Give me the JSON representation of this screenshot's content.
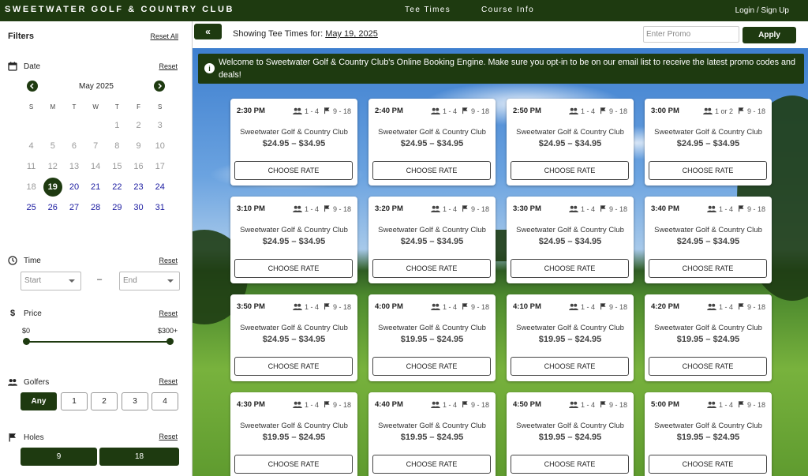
{
  "nav": {
    "brand": "SWEETWATER GOLF & COUNTRY CLUB",
    "links": [
      "Tee Times",
      "Course Info"
    ],
    "login": "Login / Sign Up"
  },
  "filters": {
    "title": "Filters",
    "reset_all": "Reset All",
    "reset": "Reset",
    "date": {
      "label": "Date",
      "month": "May 2025",
      "prev_icon": "chevron-left-icon",
      "next_icon": "chevron-right-icon",
      "weekdays": [
        "S",
        "M",
        "T",
        "W",
        "T",
        "F",
        "S"
      ],
      "days": [
        "",
        "",
        "",
        "",
        "1",
        "2",
        "3",
        "4",
        "5",
        "6",
        "7",
        "8",
        "9",
        "10",
        "11",
        "12",
        "13",
        "14",
        "15",
        "16",
        "17",
        "18",
        "19",
        "20",
        "21",
        "22",
        "23",
        "24",
        "25",
        "26",
        "27",
        "28",
        "29",
        "30",
        "31"
      ],
      "selected": "19",
      "available": [
        "20",
        "21",
        "22",
        "23",
        "24",
        "25",
        "26",
        "27",
        "28",
        "29",
        "30",
        "31"
      ]
    },
    "time": {
      "label": "Time",
      "start_placeholder": "Start",
      "end_placeholder": "End",
      "separator": "–"
    },
    "price": {
      "label": "Price",
      "min_label": "$0",
      "max_label": "$300+",
      "range": [
        0,
        300
      ]
    },
    "golfers": {
      "label": "Golfers",
      "options": [
        "Any",
        "1",
        "2",
        "3",
        "4"
      ],
      "selected": "Any"
    },
    "holes": {
      "label": "Holes",
      "options": [
        "9",
        "18"
      ]
    }
  },
  "topbar": {
    "collapse_label": "«",
    "showing_prefix": "Showing Tee Times for:",
    "showing_date": "May 19, 2025",
    "promo_placeholder": "Enter Promo",
    "apply_label": "Apply"
  },
  "banner": {
    "text": "Welcome to Sweetwater Golf & Country Club's Online Booking Engine. Make sure you opt-in to be on our email list to receive the latest promo codes and deals!"
  },
  "colors": {
    "brand": "#1e3a10",
    "available_day": "#1a1aa0"
  },
  "tee_times": [
    {
      "time": "2:30 PM",
      "players": "1 - 4",
      "holes": "9 - 18",
      "course": "Sweetwater Golf & Country Club",
      "price": "$24.95 – $34.95",
      "button": "CHOOSE RATE"
    },
    {
      "time": "2:40 PM",
      "players": "1 - 4",
      "holes": "9 - 18",
      "course": "Sweetwater Golf & Country Club",
      "price": "$24.95 – $34.95",
      "button": "CHOOSE RATE"
    },
    {
      "time": "2:50 PM",
      "players": "1 - 4",
      "holes": "9 - 18",
      "course": "Sweetwater Golf & Country Club",
      "price": "$24.95 – $34.95",
      "button": "CHOOSE RATE"
    },
    {
      "time": "3:00 PM",
      "players": "1 or 2",
      "holes": "9 - 18",
      "course": "Sweetwater Golf & Country Club",
      "price": "$24.95 – $34.95",
      "button": "CHOOSE RATE"
    },
    {
      "time": "3:10 PM",
      "players": "1 - 4",
      "holes": "9 - 18",
      "course": "Sweetwater Golf & Country Club",
      "price": "$24.95 – $34.95",
      "button": "CHOOSE RATE"
    },
    {
      "time": "3:20 PM",
      "players": "1 - 4",
      "holes": "9 - 18",
      "course": "Sweetwater Golf & Country Club",
      "price": "$24.95 – $34.95",
      "button": "CHOOSE RATE"
    },
    {
      "time": "3:30 PM",
      "players": "1 - 4",
      "holes": "9 - 18",
      "course": "Sweetwater Golf & Country Club",
      "price": "$24.95 – $34.95",
      "button": "CHOOSE RATE"
    },
    {
      "time": "3:40 PM",
      "players": "1 - 4",
      "holes": "9 - 18",
      "course": "Sweetwater Golf & Country Club",
      "price": "$24.95 – $34.95",
      "button": "CHOOSE RATE"
    },
    {
      "time": "3:50 PM",
      "players": "1 - 4",
      "holes": "9 - 18",
      "course": "Sweetwater Golf & Country Club",
      "price": "$24.95 – $34.95",
      "button": "CHOOSE RATE"
    },
    {
      "time": "4:00 PM",
      "players": "1 - 4",
      "holes": "9 - 18",
      "course": "Sweetwater Golf & Country Club",
      "price": "$19.95 – $24.95",
      "button": "CHOOSE RATE"
    },
    {
      "time": "4:10 PM",
      "players": "1 - 4",
      "holes": "9 - 18",
      "course": "Sweetwater Golf & Country Club",
      "price": "$19.95 – $24.95",
      "button": "CHOOSE RATE"
    },
    {
      "time": "4:20 PM",
      "players": "1 - 4",
      "holes": "9 - 18",
      "course": "Sweetwater Golf & Country Club",
      "price": "$19.95 – $24.95",
      "button": "CHOOSE RATE"
    },
    {
      "time": "4:30 PM",
      "players": "1 - 4",
      "holes": "9 - 18",
      "course": "Sweetwater Golf & Country Club",
      "price": "$19.95 – $24.95",
      "button": "CHOOSE RATE"
    },
    {
      "time": "4:40 PM",
      "players": "1 - 4",
      "holes": "9 - 18",
      "course": "Sweetwater Golf & Country Club",
      "price": "$19.95 – $24.95",
      "button": "CHOOSE RATE"
    },
    {
      "time": "4:50 PM",
      "players": "1 - 4",
      "holes": "9 - 18",
      "course": "Sweetwater Golf & Country Club",
      "price": "$19.95 – $24.95",
      "button": "CHOOSE RATE"
    },
    {
      "time": "5:00 PM",
      "players": "1 - 4",
      "holes": "9 - 18",
      "course": "Sweetwater Golf & Country Club",
      "price": "$19.95 – $24.95",
      "button": "CHOOSE RATE"
    }
  ]
}
